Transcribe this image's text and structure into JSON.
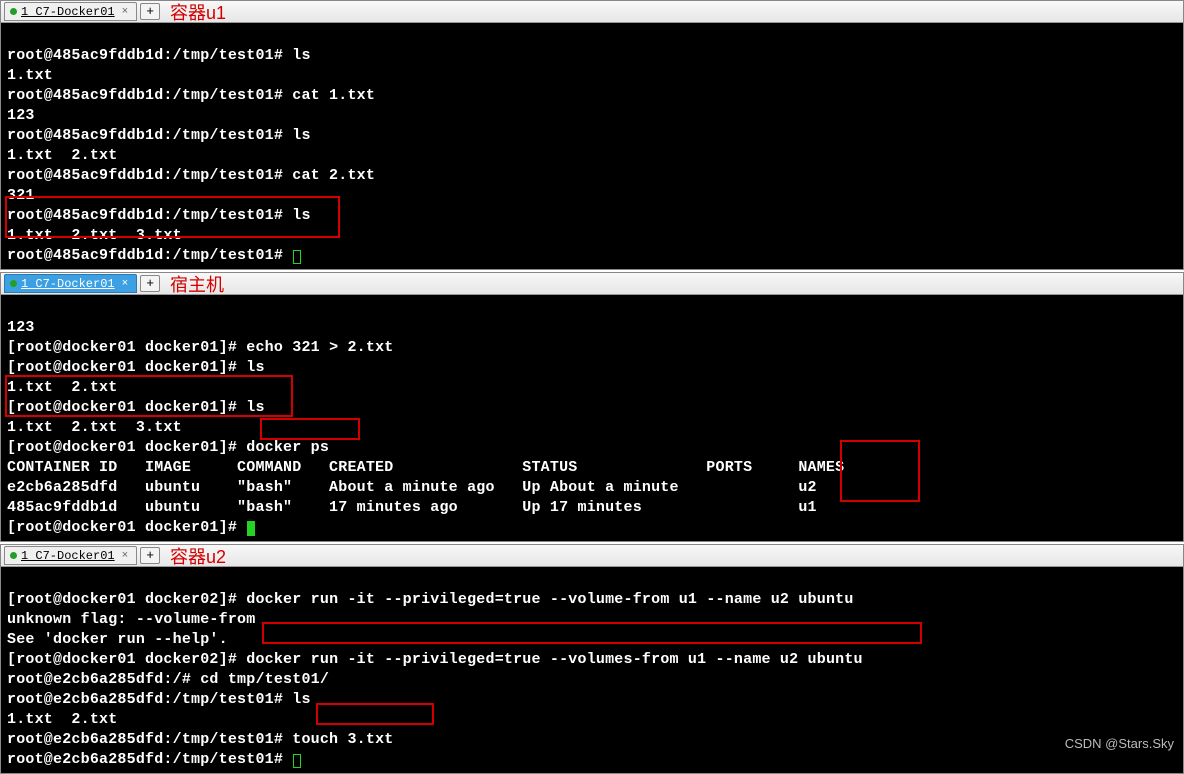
{
  "windows": {
    "w1": {
      "tab": "1 C7-Docker01",
      "annotation": "容器u1"
    },
    "w2": {
      "tab": "1 C7-Docker01",
      "annotation": "宿主机"
    },
    "w3": {
      "tab": "1 C7-Docker01",
      "annotation": "容器u2"
    }
  },
  "term1": {
    "l1_prompt": "root@485ac9fddb1d:/tmp/test01# ",
    "l1_cmd": "ls",
    "l2": "1.txt",
    "l3_prompt": "root@485ac9fddb1d:/tmp/test01# ",
    "l3_cmd": "cat 1.txt",
    "l4": "123",
    "l5_prompt": "root@485ac9fddb1d:/tmp/test01# ",
    "l5_cmd": "ls",
    "l6": "1.txt  2.txt",
    "l7_prompt": "root@485ac9fddb1d:/tmp/test01# ",
    "l7_cmd": "cat 2.txt",
    "l8": "321",
    "l9_prompt": "root@485ac9fddb1d:/tmp/test01# ",
    "l9_cmd": "ls",
    "l10": "1.txt  2.txt  3.txt",
    "l11_prompt": "root@485ac9fddb1d:/tmp/test01# "
  },
  "term2": {
    "l1": "123",
    "l2_prompt": "[root@docker01 docker01]# ",
    "l2_cmd": "echo 321 > 2.txt",
    "l3_prompt": "[root@docker01 docker01]# ",
    "l3_cmd": "ls",
    "l4": "1.txt  2.txt",
    "l5_prompt": "[root@docker01 docker01]# ",
    "l5_cmd": "ls",
    "l6": "1.txt  2.txt  3.txt",
    "l7_prompt": "[root@docker01 docker01]# ",
    "l7_cmd": "docker ps",
    "hdr": "CONTAINER ID   IMAGE     COMMAND   CREATED              STATUS              PORTS     NAMES",
    "r1": "e2cb6a285dfd   ubuntu    \"bash\"    About a minute ago   Up About a minute             u2",
    "r2": "485ac9fddb1d   ubuntu    \"bash\"    17 minutes ago       Up 17 minutes                 u1",
    "l11_prompt": "[root@docker01 docker01]# "
  },
  "term3": {
    "l1_prompt": "[root@docker01 docker02]# ",
    "l1_cmd": "docker run -it --privileged=true --volume-from u1 --name u2 ubuntu",
    "l2": "unknown flag: --volume-from",
    "l3": "See 'docker run --help'.",
    "l4_prompt": "[root@docker01 docker02]# ",
    "l4_cmd": "docker run -it --privileged=true --volumes-from u1 --name u2 ubuntu",
    "l5_prompt": "root@e2cb6a285dfd:/# ",
    "l5_cmd": "cd tmp/test01/",
    "l6_prompt": "root@e2cb6a285dfd:/tmp/test01# ",
    "l6_cmd": "ls",
    "l7": "1.txt  2.txt",
    "l8_prompt": "root@e2cb6a285dfd:/tmp/test01# ",
    "l8_cmd": "touch 3.txt",
    "l9_prompt": "root@e2cb6a285dfd:/tmp/test01# "
  },
  "watermark": "CSDN @Stars.Sky"
}
